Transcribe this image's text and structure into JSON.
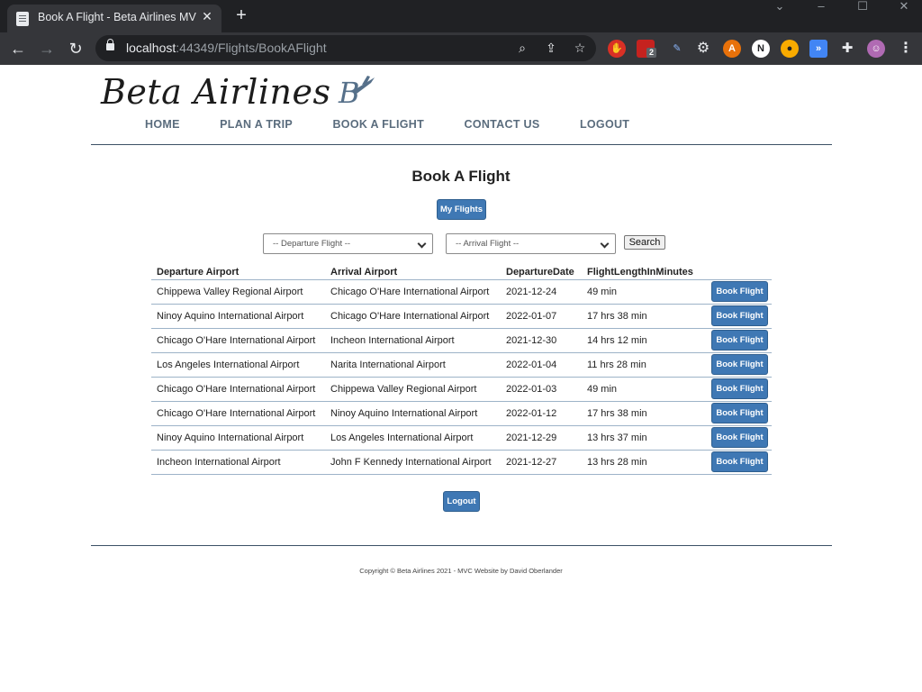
{
  "browser": {
    "tab_title": "Book A Flight - Beta Airlines MVC",
    "url_host": "localhost",
    "url_path": ":44349/Flights/BookAFlight",
    "extension_badge": "2"
  },
  "site": {
    "logo_text": "Beta Airlines",
    "logo_mark": "B",
    "nav": [
      "HOME",
      "PLAN A TRIP",
      "BOOK A FLIGHT",
      "CONTACT US",
      "LOGOUT"
    ]
  },
  "page": {
    "title": "Book A Flight",
    "my_flights_label": "My Flights",
    "departure_select": "-- Departure Flight --",
    "arrival_select": "-- Arrival Flight --",
    "search_label": "Search",
    "logout_label": "Logout",
    "copyright": "Copyright © Beta Airlines 2021 - MVC Website by David Oberlander"
  },
  "table": {
    "headers": [
      "Departure Airport",
      "Arrival Airport",
      "DepartureDate",
      "FlightLengthInMinutes",
      ""
    ],
    "book_label": "Book Flight",
    "rows": [
      [
        "Chippewa Valley Regional Airport",
        "Chicago O'Hare International Airport",
        "2021-12-24",
        "49 min"
      ],
      [
        "Ninoy Aquino International Airport",
        "Chicago O'Hare International Airport",
        "2022-01-07",
        "17 hrs 38 min"
      ],
      [
        "Chicago O'Hare International Airport",
        "Incheon International Airport",
        "2021-12-30",
        "14 hrs 12 min"
      ],
      [
        "Los Angeles International Airport",
        "Narita International Airport",
        "2022-01-04",
        "11 hrs 28 min"
      ],
      [
        "Chicago O'Hare International Airport",
        "Chippewa Valley Regional Airport",
        "2022-01-03",
        "49 min"
      ],
      [
        "Chicago O'Hare International Airport",
        "Ninoy Aquino International Airport",
        "2022-01-12",
        "17 hrs 38 min"
      ],
      [
        "Ninoy Aquino International Airport",
        "Los Angeles International Airport",
        "2021-12-29",
        "13 hrs 37 min"
      ],
      [
        "Incheon International Airport",
        "John F Kennedy International Airport",
        "2021-12-27",
        "13 hrs 28 min"
      ]
    ]
  },
  "colors": {
    "accent": "#3f78b4",
    "nav_text": "#5a6c7d",
    "divider": "#3c5166"
  }
}
